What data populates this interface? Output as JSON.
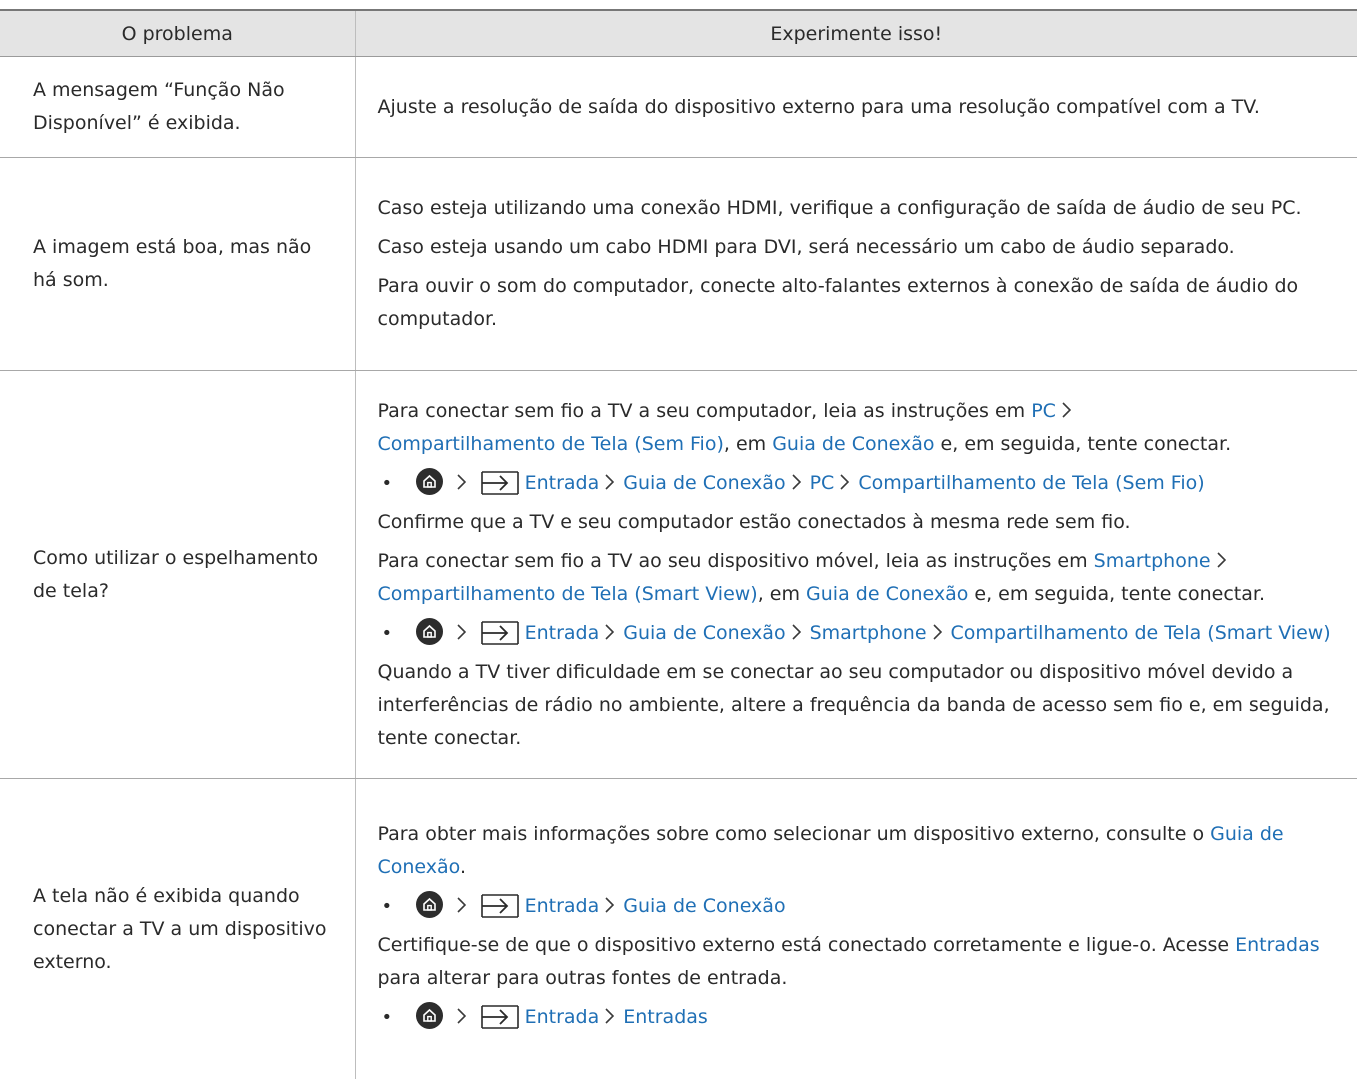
{
  "header": {
    "col_problem": "O problema",
    "col_solution": "Experimente isso!"
  },
  "rows": [
    {
      "problem": "A mensagem “Função Não Disponível” é exibida.",
      "solution": {
        "p1": "Ajuste a resolução de saída do dispositivo externo para uma resolução compatível com a TV."
      }
    },
    {
      "problem": "A imagem está boa, mas não há som.",
      "solution": {
        "p1": "Caso esteja utilizando uma conexão HDMI, verifique a configuração de saída de áudio de seu PC.",
        "p2": "Caso esteja usando um cabo HDMI para DVI, será necessário um cabo de áudio separado.",
        "p3": "Para ouvir o som do computador, conecte alto-falantes externos à conexão de saída de áudio do computador."
      }
    },
    {
      "problem": "Como utilizar o espelhamento de tela?",
      "solution": {
        "p1_a": "Para conectar sem fio a TV a seu computador, leia as instruções em ",
        "p1_link1": "PC",
        "p1_link2": "Compartilhamento de Tela (Sem Fio)",
        "p1_b": ", em ",
        "p1_link3": "Guia de Conexão",
        "p1_c": " e, em seguida, tente conectar.",
        "path1": [
          "Entrada",
          "Guia de Conexão",
          "PC",
          "Compartilhamento de Tela (Sem Fio)"
        ],
        "p2": "Confirme que a TV e seu computador estão conectados à mesma rede sem fio.",
        "p3_a": "Para conectar sem fio a TV ao seu dispositivo móvel, leia as instruções em ",
        "p3_link1": "Smartphone",
        "p3_link2": "Compartilhamento de Tela (Smart View)",
        "p3_b": ", em ",
        "p3_link3": "Guia de Conexão",
        "p3_c": " e, em seguida, tente conectar.",
        "path2": [
          "Entrada",
          "Guia de Conexão",
          "Smartphone",
          "Compartilhamento de Tela (Smart View)"
        ],
        "p4": "Quando a TV tiver dificuldade em se conectar ao seu computador ou dispositivo móvel devido a interferências de rádio no ambiente, altere a frequência da banda de acesso sem fio e, em seguida, tente conectar."
      }
    },
    {
      "problem": "A tela não é exibida quando conectar a TV a um dispositivo externo.",
      "solution": {
        "p1_a": "Para obter mais informações sobre como selecionar um dispositivo externo, consulte o ",
        "p1_link": "Guia de Conexão",
        "p1_b": ".",
        "path1": [
          "Entrada",
          "Guia de Conexão"
        ],
        "p2_a": "Certifique-se de que o dispositivo externo está conectado corretamente e ligue-o. Acesse ",
        "p2_link": "Entradas",
        "p2_b": " para alterar para outras fontes de entrada.",
        "path2": [
          "Entrada",
          "Entradas"
        ]
      }
    }
  ],
  "colors": {
    "link": "#1f6fb5",
    "header_bg": "#e4e4e4",
    "text": "#2a2a2a"
  },
  "icons": {
    "home": "home-icon",
    "input": "input-source-icon",
    "separator": "chevron-right-icon"
  }
}
